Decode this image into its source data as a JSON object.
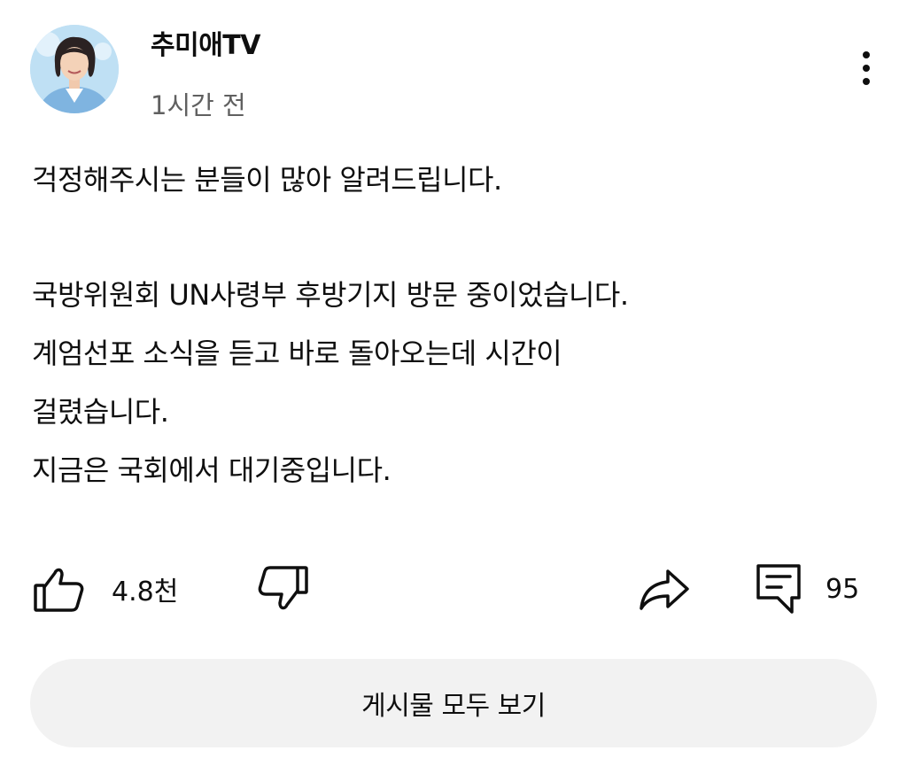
{
  "channel": {
    "name": "추미애TV",
    "time": "1시간 전",
    "avatar_icon": "profile-photo"
  },
  "post": {
    "lines_1": [
      "걱정해주시는 분들이 많아 알려드립니다."
    ],
    "lines_2": [
      "국방위원회 UN사령부 후방기지 방문 중이었습니다.",
      "계엄선포 소식을 듣고 바로 돌아오는데 시간이",
      "걸렸습니다.",
      "지금은 국회에서 대기중입니다."
    ]
  },
  "actions": {
    "like_icon": "thumbs-up-icon",
    "like_count": "4.8천",
    "dislike_icon": "thumbs-down-icon",
    "share_icon": "share-icon",
    "comment_icon": "comment-icon",
    "comment_count": "95"
  },
  "view_all": {
    "label": "게시물 모두 보기"
  },
  "colors": {
    "background": "#ffffff",
    "text": "#0f0f0f",
    "secondary_text": "#606060",
    "button_bg": "#f2f2f2"
  }
}
